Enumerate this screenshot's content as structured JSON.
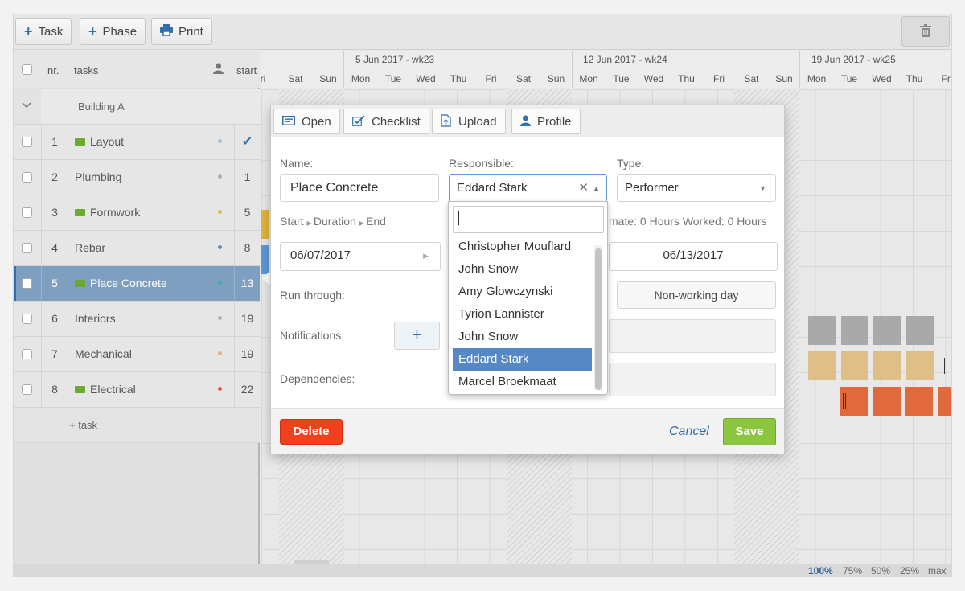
{
  "toolbar": {
    "task_label": "Task",
    "phase_label": "Phase",
    "print_label": "Print"
  },
  "grid": {
    "col_nr": "nr.",
    "col_tasks": "tasks",
    "col_start": "start",
    "group": "Building A",
    "add_task": "+ task",
    "rows": [
      {
        "nr": "1",
        "name": "Layout",
        "start": "✔",
        "dot": "#9fc3e3",
        "icon": true
      },
      {
        "nr": "2",
        "name": "Plumbing",
        "start": "1",
        "dot": "#b0b0b0",
        "icon": false
      },
      {
        "nr": "3",
        "name": "Formwork",
        "start": "5",
        "dot": "#e6b84a",
        "icon": true
      },
      {
        "nr": "4",
        "name": "Rebar",
        "start": "8",
        "dot": "#4a90d0",
        "icon": false
      },
      {
        "nr": "5",
        "name": "Place Concrete",
        "start": "13",
        "dot": "#45b1a8",
        "icon": true
      },
      {
        "nr": "6",
        "name": "Interiors",
        "start": "19",
        "dot": "#b0b0b0",
        "icon": false
      },
      {
        "nr": "7",
        "name": "Mechanical",
        "start": "19",
        "dot": "#e8b27a",
        "icon": false
      },
      {
        "nr": "8",
        "name": "Electrical",
        "start": "22",
        "dot": "#e35b3a",
        "icon": true
      }
    ]
  },
  "gantt": {
    "weeks": [
      "5 Jun 2017 - wk23",
      "12 Jun 2017 - wk24",
      "19 Jun 2017 - wk25"
    ],
    "days": [
      "ri",
      "Sat",
      "Sun",
      "Mon",
      "Tue",
      "Wed",
      "Thu",
      "Fri",
      "Sat",
      "Sun",
      "Mon",
      "Tue",
      "Wed",
      "Thu",
      "Fri",
      "Sat",
      "Sun",
      "Mon",
      "Tue",
      "Wed",
      "Thu",
      "Fri"
    ],
    "bar_colors": {
      "interiors": "#a9a9a9",
      "mechanical": "#dfbf88",
      "electrical": "#e06a3c",
      "formwork": "#e0b53a",
      "rebar": "#5b9ad6"
    }
  },
  "zoom": {
    "z100": "100%",
    "z75": "75%",
    "z50": "50%",
    "z25": "25%",
    "max": "max"
  },
  "dialog": {
    "tabs": {
      "open": "Open",
      "checklist": "Checklist",
      "upload": "Upload",
      "profile": "Profile"
    },
    "name_label": "Name:",
    "name_value": "Place Concrete",
    "responsible_label": "Responsible:",
    "responsible_value": "Eddard Stark",
    "type_label": "Type:",
    "type_value": "Performer",
    "sde_start": "Start",
    "sde_duration": "Duration",
    "sde_end": "End",
    "estimate_text": "mate: 0 Hours Worked: 0 Hours",
    "start_date": "06/07/2017",
    "end_date": "06/13/2017",
    "run_through_label": "Run through:",
    "nonworking_label": "Non-working day",
    "notifications_label": "Notifications:",
    "dependencies_label": "Dependencies:",
    "delete_label": "Delete",
    "cancel_label": "Cancel",
    "save_label": "Save"
  },
  "dropdown": {
    "search_value": "",
    "options": [
      "Christopher Mouflard",
      "John Snow",
      "Amy Glowczynski",
      "Tyrion Lannister",
      "John Snow",
      "Eddard Stark",
      "Marcel Broekmaat"
    ],
    "selected": "Eddard Stark"
  }
}
